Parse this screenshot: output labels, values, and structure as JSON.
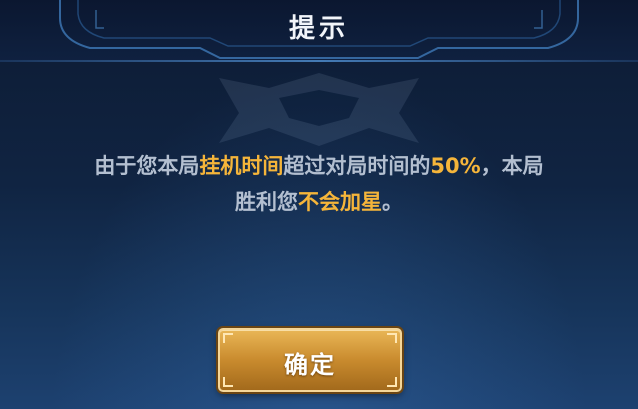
{
  "dialog": {
    "title": "提示",
    "message": {
      "line1_part1": "由于您本局",
      "line1_hl1": "挂机时间",
      "line1_part2": "超过对局时间的",
      "line1_hl2": "50%",
      "line1_part3": "，本局",
      "line2_part1": "胜利您",
      "line2_hl1": "不会加星",
      "line2_part2": "。"
    },
    "confirm_label": "确定"
  },
  "colors": {
    "highlight": "#f5b53a",
    "body_text": "#b3bfd0",
    "title_text": "#f2f5fa",
    "button_gold": "#c98b2e",
    "background": "#102442"
  }
}
